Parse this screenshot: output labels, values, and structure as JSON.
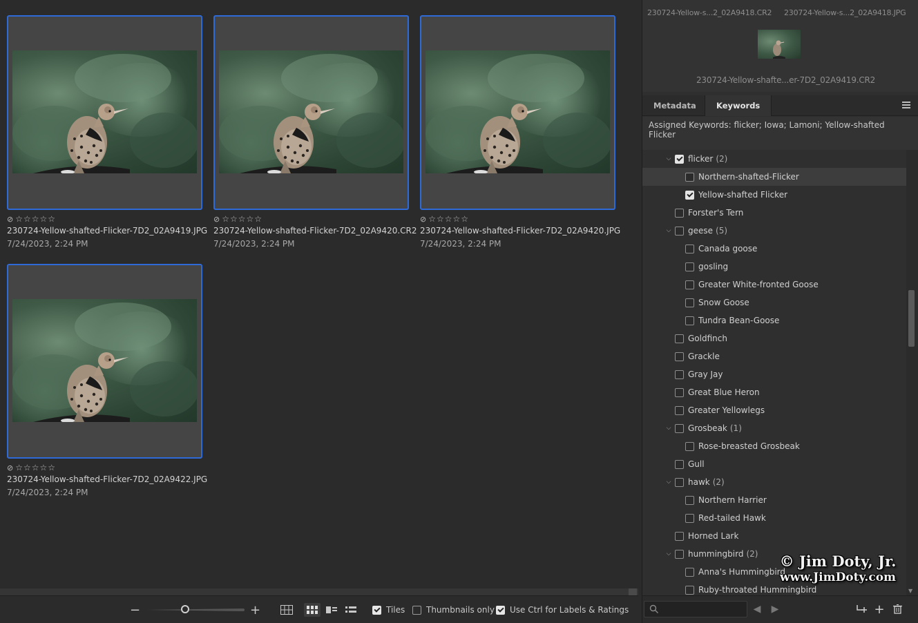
{
  "thumbnails": [
    {
      "filename": "230724-Yellow-shafted-Flicker-7D2_02A9419.JPG",
      "date": "7/24/2023, 2:24 PM",
      "rating": 0,
      "selected": true
    },
    {
      "filename": "230724-Yellow-shafted-Flicker-7D2_02A9420.CR2",
      "date": "7/24/2023, 2:24 PM",
      "rating": 0,
      "selected": true
    },
    {
      "filename": "230724-Yellow-shafted-Flicker-7D2_02A9420.JPG",
      "date": "7/24/2023, 2:24 PM",
      "rating": 0,
      "selected": true
    },
    {
      "filename": "230724-Yellow-shafted-Flicker-7D2_02A9422.JPG",
      "date": "7/24/2023, 2:24 PM",
      "rating": 0,
      "selected": true
    }
  ],
  "bottom_bar": {
    "zoom_minus": "−",
    "zoom_plus": "+",
    "zoom_level": 0.4,
    "tiles_label": "Tiles",
    "tiles_checked": true,
    "thumbs_only_label": "Thumbnails only",
    "thumbs_only_checked": false,
    "ctrl_label": "Use Ctrl for Labels & Ratings",
    "ctrl_checked": true
  },
  "preview": {
    "file_a": "230724-Yellow-s...2_02A9418.CR2",
    "file_b": "230724-Yellow-s...2_02A9418.JPG",
    "file_main": "230724-Yellow-shafte...er-7D2_02A9419.CR2"
  },
  "tabs": [
    {
      "label": "Metadata",
      "active": false
    },
    {
      "label": "Keywords",
      "active": true
    }
  ],
  "assigned_keywords": "Assigned Keywords: flicker; Iowa; Lamoni; Yellow-shafted Flicker",
  "keywords": [
    {
      "label": "flicker",
      "count": "(2)",
      "level": 0,
      "expanded": true,
      "checked": true
    },
    {
      "label": "Northern-shafted-Flicker",
      "level": 1,
      "checked": false,
      "highlighted": true
    },
    {
      "label": "Yellow-shafted Flicker",
      "level": 1,
      "checked": true
    },
    {
      "label": "Forster's Tern",
      "level": 0,
      "checked": false
    },
    {
      "label": "geese",
      "count": "(5)",
      "level": 0,
      "expanded": true,
      "checked": false
    },
    {
      "label": "Canada goose",
      "level": 1,
      "checked": false
    },
    {
      "label": "gosling",
      "level": 1,
      "checked": false
    },
    {
      "label": "Greater White-fronted Goose",
      "level": 1,
      "checked": false
    },
    {
      "label": "Snow Goose",
      "level": 1,
      "checked": false
    },
    {
      "label": "Tundra Bean-Goose",
      "level": 1,
      "checked": false
    },
    {
      "label": "Goldfinch",
      "level": 0,
      "checked": false
    },
    {
      "label": "Grackle",
      "level": 0,
      "checked": false
    },
    {
      "label": "Gray Jay",
      "level": 0,
      "checked": false
    },
    {
      "label": "Great Blue Heron",
      "level": 0,
      "checked": false
    },
    {
      "label": "Greater Yellowlegs",
      "level": 0,
      "checked": false
    },
    {
      "label": "Grosbeak",
      "count": "(1)",
      "level": 0,
      "expanded": true,
      "checked": false
    },
    {
      "label": "Rose-breasted Grosbeak",
      "level": 1,
      "checked": false
    },
    {
      "label": "Gull",
      "level": 0,
      "checked": false
    },
    {
      "label": "hawk",
      "count": "(2)",
      "level": 0,
      "expanded": true,
      "checked": false
    },
    {
      "label": "Northern Harrier",
      "level": 1,
      "checked": false
    },
    {
      "label": "Red-tailed Hawk",
      "level": 1,
      "checked": false
    },
    {
      "label": "Horned Lark",
      "level": 0,
      "checked": false
    },
    {
      "label": "hummingbird",
      "count": "(2)",
      "level": 0,
      "expanded": true,
      "checked": false
    },
    {
      "label": "Anna's Hummingbird",
      "level": 1,
      "checked": false
    },
    {
      "label": "Ruby-throated Hummingbird",
      "level": 1,
      "checked": false
    }
  ],
  "watermark": {
    "line1": "© Jim Doty, Jr.",
    "line2": "www.JimDoty.com"
  },
  "icons": {
    "reject": "reject-icon",
    "star": "star-outline-icon",
    "search": "search-icon",
    "prev": "arrow-left-icon",
    "next": "arrow-right-icon",
    "new_sub": "new-sub-keyword-icon",
    "new": "add-icon",
    "delete": "trash-icon"
  }
}
